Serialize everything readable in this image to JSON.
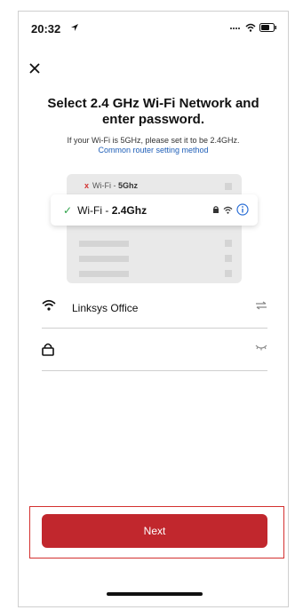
{
  "status_bar": {
    "time": "20:32",
    "icons": [
      "location-arrow-icon",
      "signal-icon",
      "wifi-icon",
      "battery-icon"
    ]
  },
  "header": {
    "close_icon": "close-icon"
  },
  "content": {
    "title": "Select 2.4 GHz Wi-Fi Network and enter password.",
    "hint": "If your Wi-Fi is 5GHz, please set it to be 2.4GHz.",
    "link": "Common router setting method"
  },
  "illustration": {
    "bad_option": {
      "prefix": "Wi-Fi - ",
      "band": "5Ghz",
      "status": "x"
    },
    "good_option": {
      "prefix": "Wi-Fi - ",
      "band": "2.4Ghz",
      "status": "✓"
    }
  },
  "form": {
    "ssid_value": "Linksys Office",
    "password_value": ""
  },
  "footer": {
    "next_label": "Next"
  },
  "colors": {
    "accent": "#c1272d",
    "link": "#1f5fb8",
    "check": "#2fa34a",
    "error": "#d3302f"
  }
}
